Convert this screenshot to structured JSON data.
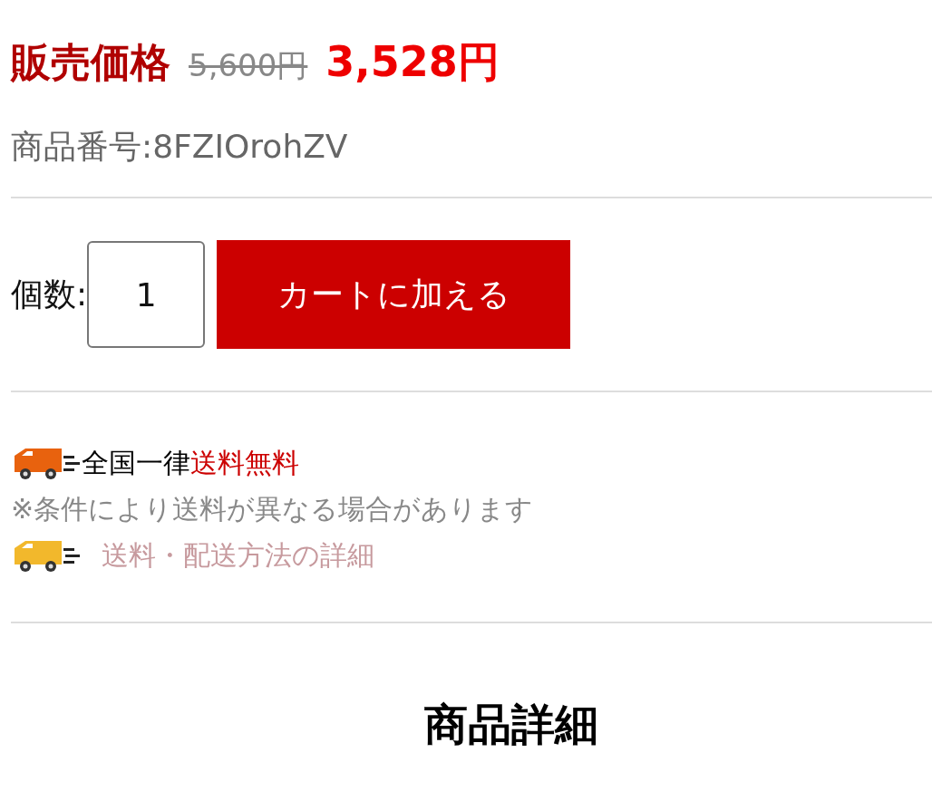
{
  "price": {
    "label": "販売価格",
    "original": "5,600円",
    "sale": "3,528円"
  },
  "product_number": "商品番号:8FZIOrohZV",
  "quantity": {
    "label": "個数:",
    "value": "1"
  },
  "cart_button": "カートに加える",
  "shipping": {
    "prefix": "全国一律",
    "highlight": "送料無料",
    "note": "※条件により送料が異なる場合があります",
    "details_link": "送料・配送方法の詳細"
  },
  "section_heading": "商品詳細"
}
